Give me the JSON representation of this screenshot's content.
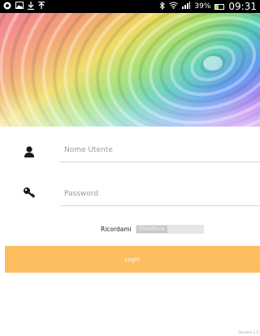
{
  "status_bar": {
    "battery_percent": "39%",
    "battery_level": 0.39,
    "time": "09:31"
  },
  "form": {
    "username_placeholder": "Nome Utente",
    "password_placeholder": "Password",
    "remember_label": "Ricordami",
    "remember_toggle_text": "Disattiva",
    "login_label": "Login"
  },
  "footer": {
    "text": "Versione 1.0"
  },
  "colors": {
    "login_button": "#fdbe5f",
    "status_bar": "#000000",
    "input_underline": "#d6d6d6",
    "placeholder": "#9a9a9a"
  },
  "icons": {
    "status_left": [
      "chrome-icon",
      "image-icon",
      "download-icon",
      "upload-icon"
    ],
    "status_right": [
      "bluetooth-icon",
      "wifi-icon",
      "signal-icon",
      "battery-icon"
    ],
    "username": "user-icon",
    "password": "key-icon"
  }
}
